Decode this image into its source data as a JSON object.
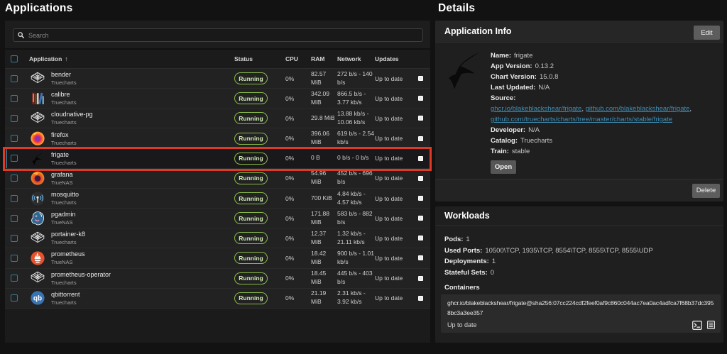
{
  "left": {
    "title": "Applications",
    "search_placeholder": "Search",
    "table": {
      "headers": {
        "application": "Application",
        "status": "Status",
        "cpu": "CPU",
        "ram": "RAM",
        "network": "Network",
        "updates": "Updates"
      },
      "sort_arrow": "↑",
      "rows": [
        {
          "name": "bender",
          "catalog": "Truecharts",
          "status": "Running",
          "cpu": "0%",
          "ram": "82.57 MiB",
          "network": "272 b/s - 140 b/s",
          "updates": "Up to date",
          "icon": "truecharts-cube",
          "selected": false
        },
        {
          "name": "calibre",
          "catalog": "Truecharts",
          "status": "Running",
          "cpu": "0%",
          "ram": "342.09 MiB",
          "network": "866.5 b/s - 3.77 kb/s",
          "updates": "Up to date",
          "icon": "calibre-books",
          "selected": false
        },
        {
          "name": "cloudnative-pg",
          "catalog": "Truecharts",
          "status": "Running",
          "cpu": "0%",
          "ram": "29.8 MiB",
          "network": "13.88 kb/s - 10.06 kb/s",
          "updates": "Up to date",
          "icon": "truecharts-cube",
          "selected": false
        },
        {
          "name": "firefox",
          "catalog": "Truecharts",
          "status": "Running",
          "cpu": "0%",
          "ram": "396.06 MiB",
          "network": "619 b/s - 2.54 kb/s",
          "updates": "Up to date",
          "icon": "firefox",
          "selected": false
        },
        {
          "name": "frigate",
          "catalog": "Truecharts",
          "status": "Running",
          "cpu": "0%",
          "ram": "0 B",
          "network": "0 b/s - 0 b/s",
          "updates": "Up to date",
          "icon": "frigate-bird",
          "selected": true
        },
        {
          "name": "grafana",
          "catalog": "TrueNAS",
          "status": "Running",
          "cpu": "0%",
          "ram": "54.96 MiB",
          "network": "452 b/s - 696 b/s",
          "updates": "Up to date",
          "icon": "grafana",
          "selected": false
        },
        {
          "name": "mosquitto",
          "catalog": "Truecharts",
          "status": "Running",
          "cpu": "0%",
          "ram": "700 KiB",
          "network": "4.84 kb/s - 4.57 kb/s",
          "updates": "Up to date",
          "icon": "mosquitto",
          "selected": false
        },
        {
          "name": "pgadmin",
          "catalog": "TrueNAS",
          "status": "Running",
          "cpu": "0%",
          "ram": "171.88 MiB",
          "network": "583 b/s - 882 b/s",
          "updates": "Up to date",
          "icon": "pgadmin",
          "selected": false
        },
        {
          "name": "portainer-k8",
          "catalog": "Truecharts",
          "status": "Running",
          "cpu": "0%",
          "ram": "12.37 MiB",
          "network": "1.32 kb/s - 21.11 kb/s",
          "updates": "Up to date",
          "icon": "truecharts-cube",
          "selected": false
        },
        {
          "name": "prometheus",
          "catalog": "TrueNAS",
          "status": "Running",
          "cpu": "0%",
          "ram": "18.42 MiB",
          "network": "900 b/s - 1.01 kb/s",
          "updates": "Up to date",
          "icon": "prometheus",
          "selected": false
        },
        {
          "name": "prometheus-operator",
          "catalog": "Truecharts",
          "status": "Running",
          "cpu": "0%",
          "ram": "18.45 MiB",
          "network": "445 b/s - 403 b/s",
          "updates": "Up to date",
          "icon": "truecharts-cube",
          "selected": false
        },
        {
          "name": "qbittorrent",
          "catalog": "Truecharts",
          "status": "Running",
          "cpu": "0%",
          "ram": "21.19 MiB",
          "network": "2.31 kb/s - 3.92 kb/s",
          "updates": "Up to date",
          "icon": "qbittorrent",
          "selected": false
        }
      ]
    },
    "highlight_color": "#df3a25"
  },
  "details": {
    "title": "Details",
    "app_info": {
      "title": "Application Info",
      "edit_button": "Edit",
      "app_icon": "frigate-bird",
      "fields": [
        {
          "label": "Name:",
          "value": "frigate"
        },
        {
          "label": "App Version:",
          "value": "0.13.2"
        },
        {
          "label": "Chart Version:",
          "value": "15.0.8"
        },
        {
          "label": "Last Updated:",
          "value": "N/A"
        }
      ],
      "source_label": "Source:",
      "sources": [
        "ghcr.io/blakeblackshear/frigate",
        "github.com/blakeblackshear/frigate",
        "github.com/truecharts/charts/tree/master/charts/stable/frigate"
      ],
      "fields2": [
        {
          "label": "Developer:",
          "value": "N/A"
        },
        {
          "label": "Catalog:",
          "value": "Truecharts"
        },
        {
          "label": "Train:",
          "value": "stable"
        }
      ],
      "open_button": "Open",
      "delete_button": "Delete",
      "link_color": "#3e8cb4"
    },
    "workloads": {
      "title": "Workloads",
      "fields": [
        {
          "label": "Pods:",
          "value": "1"
        },
        {
          "label": "Used Ports:",
          "value": "10500\\TCP, 1935\\TCP, 8554\\TCP, 8555\\TCP, 8555\\UDP"
        },
        {
          "label": "Deployments:",
          "value": "1"
        },
        {
          "label": "Stateful Sets:",
          "value": "0"
        }
      ],
      "containers_label": "Containers",
      "container_image": "ghcr.io/blakeblackshear/frigate@sha256:07cc224cdf2feef0af9c860c044ac7ea0ac4adfca7f68b37dc3958bc3a3ee357",
      "container_status": "Up to date",
      "container_icons": [
        "shell-icon",
        "logs-icon"
      ]
    },
    "status_color": "#87ba45"
  }
}
